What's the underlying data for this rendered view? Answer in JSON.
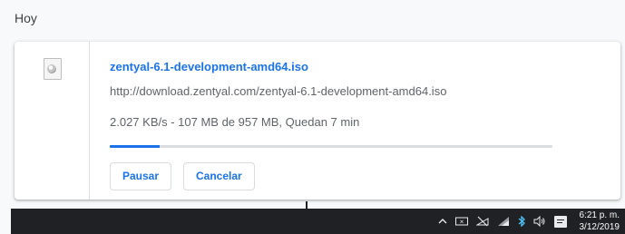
{
  "section": {
    "title": "Hoy"
  },
  "download": {
    "file_icon": "iso-file-icon",
    "filename": "zentyal-6.1-development-amd64.iso",
    "url": "http://download.zentyal.com/zentyal-6.1-development-amd64.iso",
    "status": "2.027 KB/s - 107 MB de 957 MB, Quedan 7 min",
    "progress_percent": 11.2,
    "pause_label": "Pausar",
    "cancel_label": "Cancelar",
    "accent_color": "#1a73e8"
  },
  "taskbar": {
    "tray_icons": [
      "chevron-up-icon",
      "language-icon",
      "network-off-icon",
      "wifi-icon",
      "bluetooth-icon",
      "volume-icon",
      "notification-icon"
    ],
    "time": "6:21 p. m.",
    "date": "3/12/2019"
  }
}
